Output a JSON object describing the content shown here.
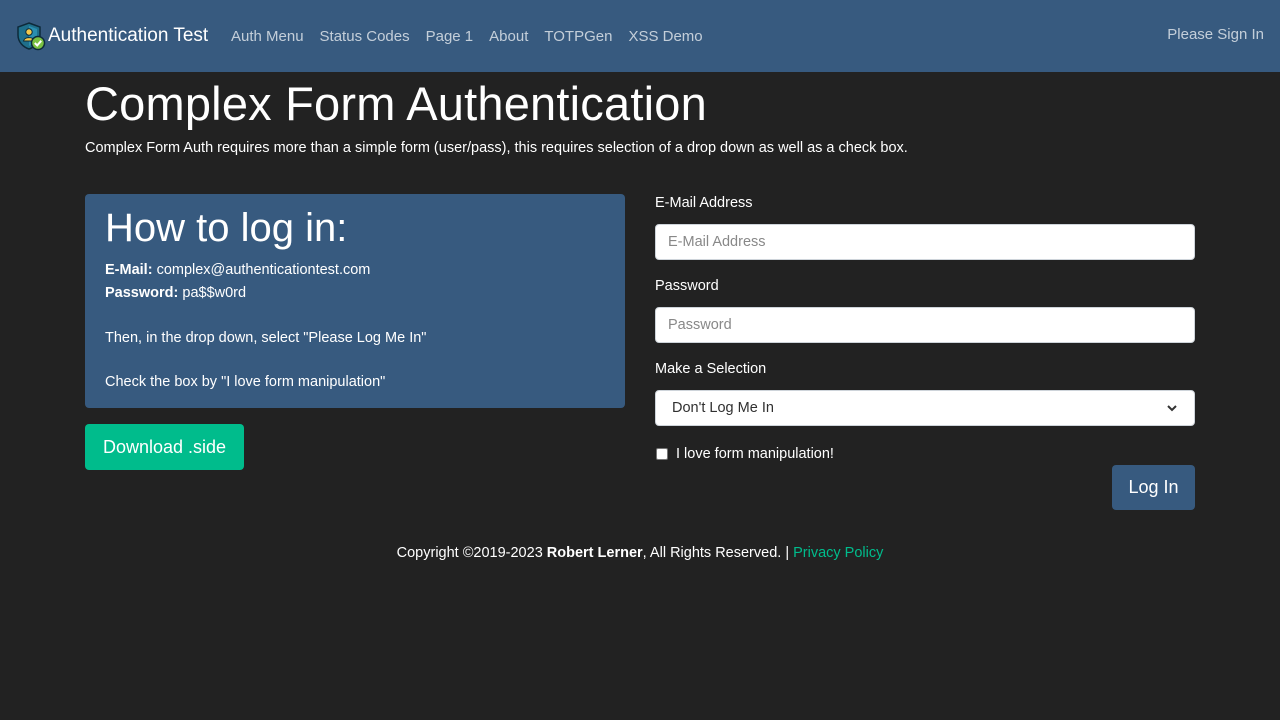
{
  "navbar": {
    "brand": "Authentication Test",
    "brand_icon": "shield-check-icon",
    "links": [
      "Auth Menu",
      "Status Codes",
      "Page 1",
      "About",
      "TOTPGen",
      "XSS Demo"
    ],
    "sign_in": "Please Sign In",
    "color": "#375a7f"
  },
  "page": {
    "title": "Complex Form Authentication",
    "lead": "Complex Form Auth requires more than a simple form (user/pass), this requires selection of a drop down as well as a check box."
  },
  "info": {
    "heading": "How to log in:",
    "email_label": "E-Mail:",
    "email_value": "complex@authenticationtest.com",
    "password_label": "Password:",
    "password_value": "pa$$w0rd",
    "step_dropdown": "Then, in the drop down, select \"Please Log Me In\"",
    "step_checkbox": "Check the box by \"I love form manipulation\""
  },
  "download_button": "Download .side",
  "form": {
    "email_label": "E-Mail Address",
    "email_placeholder": "E-Mail Address",
    "email_value": "",
    "password_label": "Password",
    "password_placeholder": "Password",
    "password_value": "",
    "selection_label": "Make a Selection",
    "selection_value": "Don't Log Me In",
    "checkbox_label": "I love form manipulation!",
    "checkbox_checked": false,
    "submit_label": "Log In"
  },
  "footer": {
    "copyright_prefix": "Copyright ©2019-2023 ",
    "author": "Robert Lerner",
    "copyright_suffix": ", All Rights Reserved. | ",
    "privacy_link": "Privacy Policy"
  },
  "colors": {
    "background": "#222222",
    "primary": "#375a7f",
    "success": "#00bc8c"
  }
}
